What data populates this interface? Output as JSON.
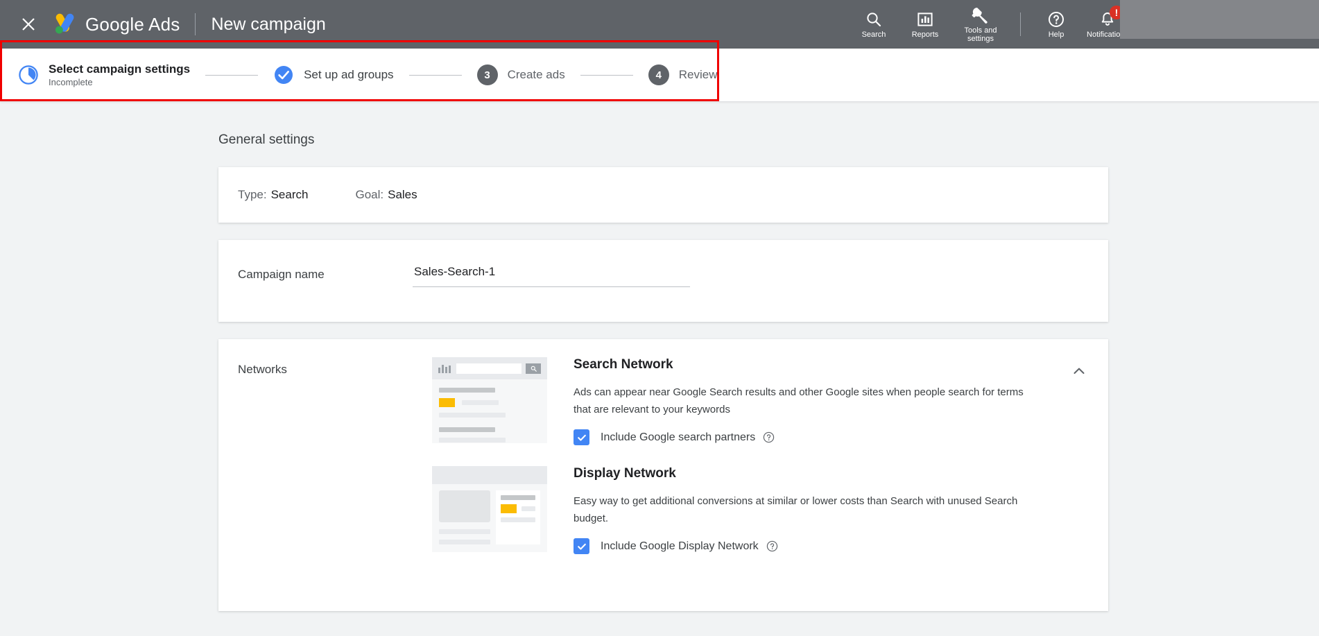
{
  "header": {
    "close_icon": "close-icon",
    "brand": "Google Ads",
    "page_title": "New campaign",
    "tools": [
      {
        "icon": "search-icon",
        "label": "Search"
      },
      {
        "icon": "reports-bar-chart-icon",
        "label": "Reports"
      },
      {
        "icon": "wrench-icon",
        "label": "Tools and\nsettings"
      },
      {
        "icon": "help-circle-icon",
        "label": "Help"
      },
      {
        "icon": "bell-icon",
        "label": "Notifications",
        "badge": "!"
      }
    ]
  },
  "stepper": {
    "steps": [
      {
        "marker": "progress-pie",
        "label": "Select campaign settings",
        "sublabel": "Incomplete",
        "state": "active"
      },
      {
        "marker": "check",
        "label": "Set up ad groups",
        "state": "complete"
      },
      {
        "marker": "3",
        "label": "Create ads",
        "state": "pending"
      },
      {
        "marker": "4",
        "label": "Review",
        "state": "pending"
      }
    ]
  },
  "main": {
    "section_title": "General settings",
    "type_goal": {
      "type_label": "Type:",
      "type_value": "Search",
      "goal_label": "Goal:",
      "goal_value": "Sales"
    },
    "campaign_name": {
      "label": "Campaign name",
      "value": "Sales-Search-1",
      "placeholder": "Campaign name"
    },
    "networks": {
      "label": "Networks",
      "collapse_icon": "chevron-up-icon",
      "items": [
        {
          "title": "Search Network",
          "description": "Ads can appear near Google Search results and other Google sites when people search for terms that are relevant to your keywords",
          "checkbox_label": "Include Google search partners",
          "checked": true,
          "help_icon": "help-circle-icon"
        },
        {
          "title": "Display Network",
          "description": "Easy way to get additional conversions at similar or lower costs than Search with unused Search budget.",
          "checkbox_label": "Include Google Display Network",
          "checked": true,
          "help_icon": "help-circle-icon"
        }
      ]
    }
  },
  "colors": {
    "header_bg": "#5f6368",
    "header_panel": "#84868a",
    "page_bg": "#f1f3f4",
    "accent_blue": "#4285f4",
    "badge_red": "#d93025",
    "annotation_red": "#f00000",
    "ad_yellow": "#fbbc04"
  }
}
